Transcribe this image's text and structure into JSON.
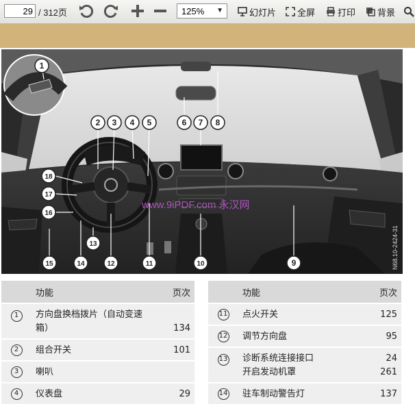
{
  "toolbar": {
    "page_current": "29",
    "page_total": "/ 312页",
    "zoom_value": "125%",
    "slideshow_label": "幻灯片",
    "fullscreen_label": "全屏",
    "print_label": "打印",
    "background_label": "背景"
  },
  "figure": {
    "code": "N68.10-2424-31",
    "watermark": "www.9iPDF.com 永汉网",
    "callouts": [
      "1",
      "2",
      "3",
      "4",
      "5",
      "6",
      "7",
      "8",
      "9",
      "10",
      "11",
      "12",
      "13",
      "14",
      "15",
      "16",
      "17",
      "18"
    ]
  },
  "table_left": {
    "header_function": "功能",
    "header_page": "页次",
    "rows": [
      {
        "num": "1",
        "lines": [
          "方向盘换档拨片（自动变速",
          "箱）"
        ],
        "page": "134"
      },
      {
        "num": "2",
        "lines": [
          "组合开关"
        ],
        "page": "101"
      },
      {
        "num": "3",
        "lines": [
          "喇叭"
        ],
        "page": ""
      },
      {
        "num": "4",
        "lines": [
          "仪表盘"
        ],
        "page": "29"
      }
    ]
  },
  "table_right": {
    "header_function": "功能",
    "header_page": "页次",
    "rows": [
      {
        "num": "11",
        "lines": [
          "点火开关"
        ],
        "page": "125"
      },
      {
        "num": "12",
        "lines": [
          "调节方向盘"
        ],
        "page": "95"
      },
      {
        "num": "13",
        "lines": [
          "诊断系统连接接口",
          "开启发动机罩"
        ],
        "pages": [
          "24",
          "261"
        ]
      },
      {
        "num": "14",
        "lines": [
          "驻车制动警告灯"
        ],
        "page": "137"
      }
    ]
  },
  "colors": {
    "toolbar_band": "#d2b47a",
    "table_header": "#d9d9d9",
    "table_row": "#efefef"
  }
}
